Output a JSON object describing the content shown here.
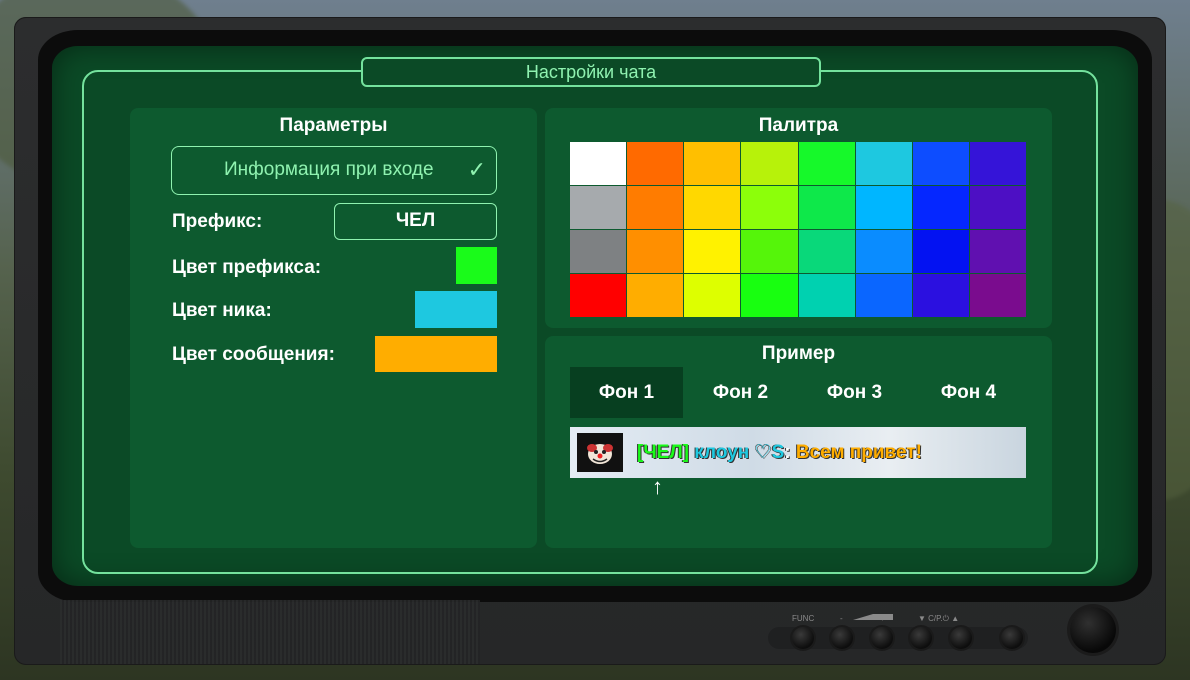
{
  "window": {
    "title": "Настройки чата"
  },
  "params": {
    "title": "Параметры",
    "login_info_label": "Информация при входе",
    "login_info_checked": true,
    "prefix_label": "Префикс:",
    "prefix_value": "ЧЕЛ",
    "prefix_color_label": "Цвет префикса:",
    "prefix_color": "#1afb1a",
    "nick_color_label": "Цвет ника:",
    "nick_color": "#1ec8e0",
    "message_color_label": "Цвет сообщения:",
    "message_color": "#ffad00"
  },
  "palette": {
    "title": "Палитра",
    "rows": [
      [
        "#ffffff",
        "#ff6a00",
        "#ffbf00",
        "#b7f20a",
        "#16f92a",
        "#1ec8e0",
        "#0d4dff",
        "#3514d8"
      ],
      [
        "#a6aaad",
        "#ff7c00",
        "#ffd800",
        "#8cff0a",
        "#0ee84a",
        "#00b6ff",
        "#0527ff",
        "#4d0fc4"
      ],
      [
        "#7e8183",
        "#ff8f00",
        "#fff200",
        "#55f50a",
        "#09d87a",
        "#0a8cff",
        "#0312f2",
        "#6010b0"
      ],
      [
        "#ff0000",
        "#ffad00",
        "#ddff00",
        "#18ff10",
        "#00d1b0",
        "#0a66ff",
        "#2b10e0",
        "#7a0c8e"
      ]
    ]
  },
  "example": {
    "title": "Пример",
    "tabs": [
      "Фон 1",
      "Фон 2",
      "Фон 3",
      "Фон 4"
    ],
    "active_tab": 0,
    "preview": {
      "prefix": "[ЧЕЛ]",
      "nick": "клоун ♡S",
      "separator": ":",
      "message": "Всем привет!"
    },
    "arrow": "↑"
  },
  "controls": {
    "func_label": "FUNC",
    "minus_label": "-",
    "plus_label": "+",
    "cp_label": "▼ C/P.⏻ ▲"
  }
}
